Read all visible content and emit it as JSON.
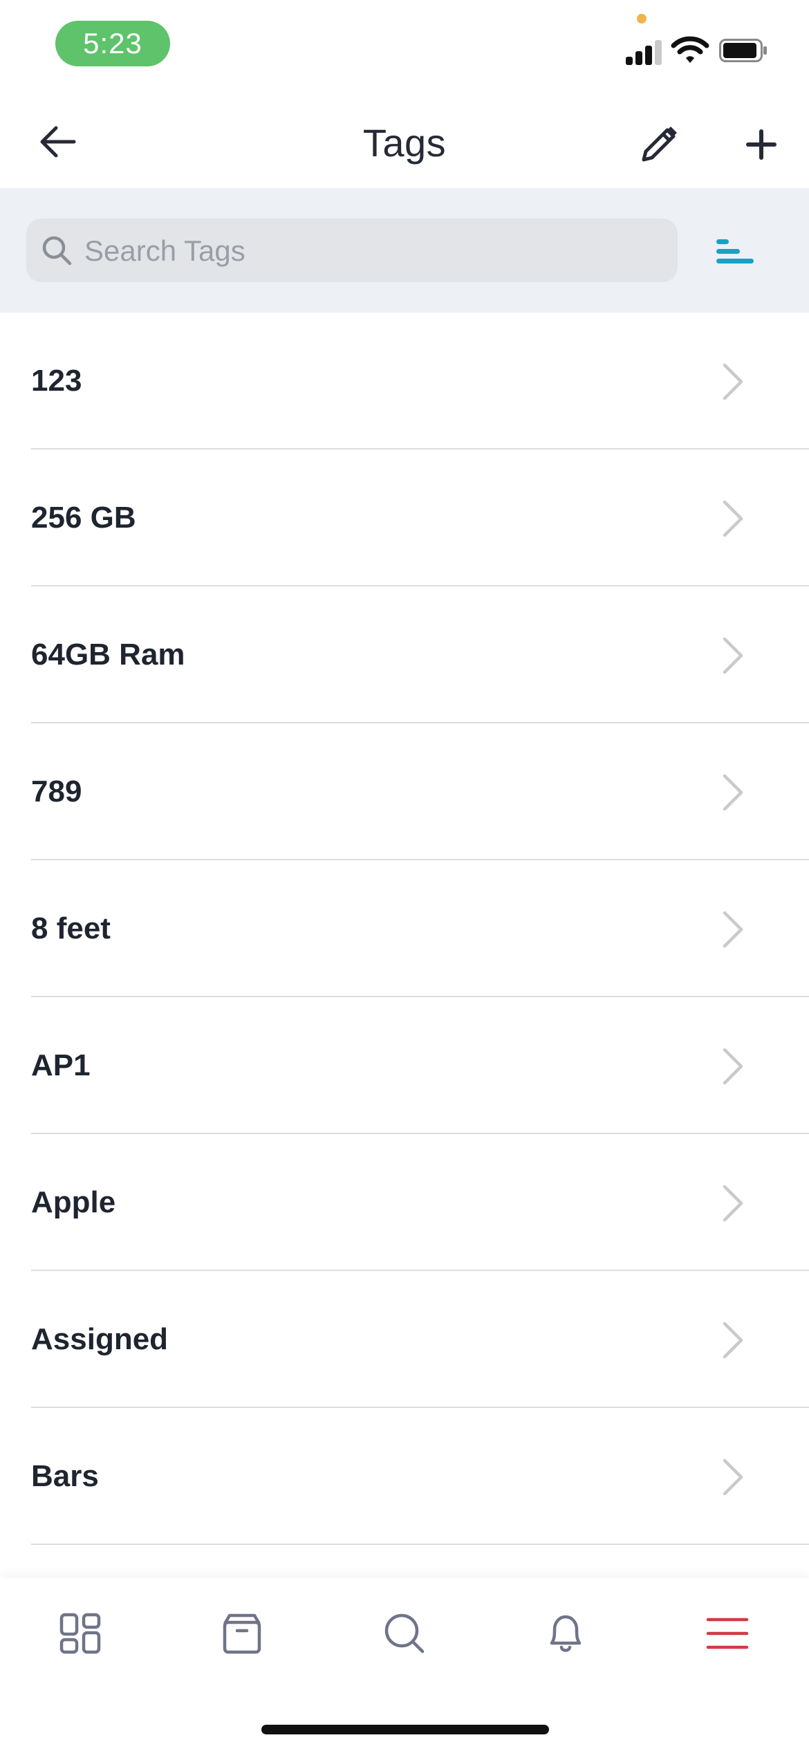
{
  "status_bar": {
    "time": "5:23"
  },
  "header": {
    "title": "Tags"
  },
  "search": {
    "placeholder": "Search Tags",
    "value": ""
  },
  "tags": [
    {
      "label": "123"
    },
    {
      "label": "256 GB"
    },
    {
      "label": "64GB Ram"
    },
    {
      "label": "789"
    },
    {
      "label": "8 feet"
    },
    {
      "label": "AP1"
    },
    {
      "label": "Apple"
    },
    {
      "label": "Assigned"
    },
    {
      "label": "Bars"
    }
  ],
  "tab_bar": {
    "items": [
      {
        "icon": "dashboard-icon",
        "active": false
      },
      {
        "icon": "box-icon",
        "active": false
      },
      {
        "icon": "search-icon",
        "active": false
      },
      {
        "icon": "bell-icon",
        "active": false
      },
      {
        "icon": "menu-icon",
        "active": true
      }
    ]
  },
  "colors": {
    "accent": "#1aa0c8",
    "active_tab": "#d23b45",
    "inactive_tab": "#707489",
    "status_pill": "#5ec36a",
    "search_strip": "#edf0f4",
    "search_field": "#e2e4e8",
    "chevron": "#c9cacd"
  }
}
